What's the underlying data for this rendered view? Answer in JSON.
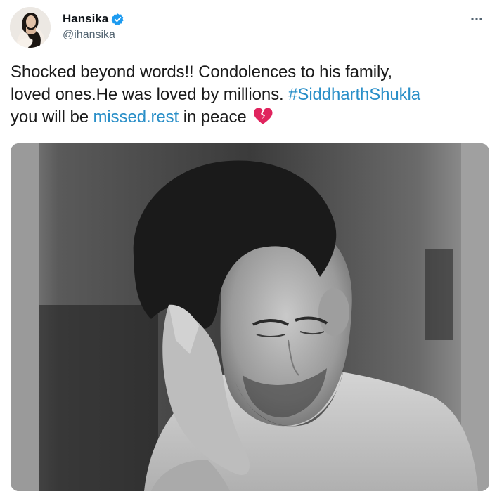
{
  "tweet": {
    "author": {
      "display_name": "Hansika",
      "handle": "@ihansika",
      "verified": true,
      "avatar_icon": "profile-photo"
    },
    "more_icon": "more-horizontal-icon",
    "text": {
      "part1": "Shocked beyond words!! Condolences to his family,",
      "part2": "loved ones.He was loved by millions. ",
      "hashtag": "#SiddharthShukla",
      "part3": "you will be ",
      "link": "missed.rest",
      "part4": " in peace",
      "emoji": "broken-heart-icon"
    },
    "media": {
      "type": "black-and-white photo",
      "icon": "photo"
    }
  },
  "colors": {
    "accent": "#2a8fc8",
    "verified": "#1d9bf0",
    "handle": "#536471",
    "heart": "#e0245e"
  }
}
